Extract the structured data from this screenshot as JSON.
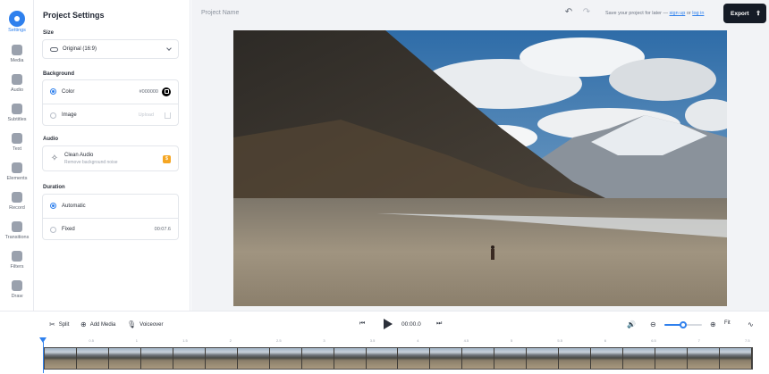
{
  "rail": {
    "items": [
      {
        "label": "Settings",
        "icon": "gear-icon",
        "active": true
      },
      {
        "label": "Media",
        "icon": "plus-icon"
      },
      {
        "label": "Audio",
        "icon": "music-icon"
      },
      {
        "label": "Subtitles",
        "icon": "subtitles-icon"
      },
      {
        "label": "Text",
        "icon": "text-icon"
      },
      {
        "label": "Elements",
        "icon": "shapes-icon"
      },
      {
        "label": "Record",
        "icon": "record-icon"
      },
      {
        "label": "Transitions",
        "icon": "transitions-icon"
      },
      {
        "label": "Filters",
        "icon": "filters-icon"
      },
      {
        "label": "Draw",
        "icon": "pen-icon"
      }
    ],
    "help_label": "?"
  },
  "panel": {
    "title": "Project Settings",
    "size": {
      "label": "Size",
      "value": "Original (16:9)"
    },
    "background": {
      "label": "Background",
      "color_label": "Color",
      "color_value": "#000000",
      "image_label": "Image",
      "image_action": "Upload"
    },
    "audio": {
      "label": "Audio",
      "clean_title": "Clean Audio",
      "clean_sub": "Remove background noise",
      "badge": "$"
    },
    "duration": {
      "label": "Duration",
      "automatic_label": "Automatic",
      "fixed_label": "Fixed",
      "fixed_value": "00:07.6"
    }
  },
  "header": {
    "project_name": "Project Name",
    "save_text": "Save your project for later —",
    "signup": "sign up",
    "or": "or",
    "login": "log in",
    "export_label": "Export"
  },
  "toolbar": {
    "split": "Split",
    "add_media": "Add Media",
    "voiceover": "Voiceover",
    "time": "00:00.0",
    "fit": "Fit",
    "zoom_level": 0.5
  },
  "timeline": {
    "ticks": [
      "",
      "0.5",
      "1",
      "1.5",
      "2",
      "2.5",
      "3",
      "3.5",
      "4",
      "4.5",
      "5",
      "5.5",
      "6",
      "6.5",
      "7",
      "7.5"
    ],
    "frames": 22
  },
  "colors": {
    "accent": "#2f80ed",
    "export_bg": "#151b26",
    "badge": "#f5a623"
  }
}
